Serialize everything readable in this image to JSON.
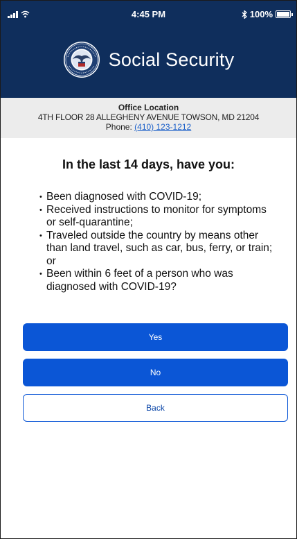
{
  "status_bar": {
    "time": "4:45 PM",
    "battery_text": "100%"
  },
  "header": {
    "brand_name": "Social Security"
  },
  "office": {
    "title": "Office Location",
    "address": "4TH FLOOR 28 ALLEGHENY AVENUE TOWSON, MD 21204",
    "phone_label": "Phone:",
    "phone_number": "(410) 123-1212"
  },
  "screening": {
    "question": "In the last 14 days, have you:",
    "items": [
      "Been diagnosed with COVID-19;",
      "Received instructions to monitor for symptoms or self-quarantine;",
      "Traveled outside the country by means other than land travel, such as car, bus, ferry, or train; or",
      "Been within 6 feet of a person who was diagnosed with COVID-19?"
    ]
  },
  "actions": {
    "yes_label": "Yes",
    "no_label": "No",
    "back_label": "Back"
  },
  "colors": {
    "header_bg": "#0f2e5c",
    "primary_button": "#0b56d6",
    "office_bg": "#ececec",
    "link": "#1a5fc9"
  },
  "icons": {
    "signal": "cellular-signal-icon",
    "wifi": "wifi-icon",
    "bluetooth": "bluetooth-icon",
    "battery": "battery-icon",
    "seal": "ssa-seal-logo"
  }
}
